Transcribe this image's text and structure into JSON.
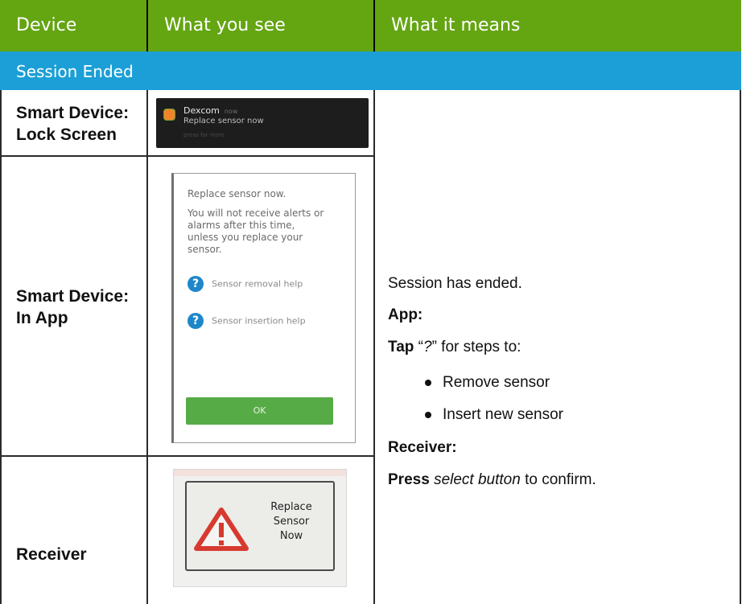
{
  "header": {
    "col_device": "Device",
    "col_see": "What you see",
    "col_means": "What it means"
  },
  "section_title": "Session Ended",
  "rows": {
    "lock_label_1": "Smart Device:",
    "lock_label_2": "Lock Screen",
    "app_label_1": "Smart Device:",
    "app_label_2": "In App",
    "receiver_label": "Receiver"
  },
  "lock_screen": {
    "app_name": "Dexcom",
    "time": "now",
    "message": "Replace sensor now",
    "hint": "press for more"
  },
  "in_app": {
    "title": "Replace sensor now.",
    "body": "You will not receive alerts or alarms after this time, unless you replace your sensor.",
    "help_removal": "Sensor removal help",
    "help_insertion": "Sensor insertion help",
    "ok": "OK"
  },
  "receiver_screen": {
    "line1": "Replace",
    "line2": "Sensor",
    "line3": "Now"
  },
  "meaning": {
    "line1": "Session has ended.",
    "app_heading": "App:",
    "tap": "Tap",
    "tap_rest_1": " “",
    "question": "?",
    "tap_rest_2": "” for steps to:",
    "bullet1": "Remove sensor",
    "bullet2": "Insert new sensor",
    "receiver_heading": "Receiver:",
    "press": "Press",
    "select_button": "select button",
    "press_rest": " to confirm."
  },
  "colors": {
    "header_green": "#64a512",
    "section_blue": "#1c9fd6",
    "ok_green": "#57ab47",
    "help_blue": "#1f87c9",
    "warning_red": "#d63a2f"
  }
}
